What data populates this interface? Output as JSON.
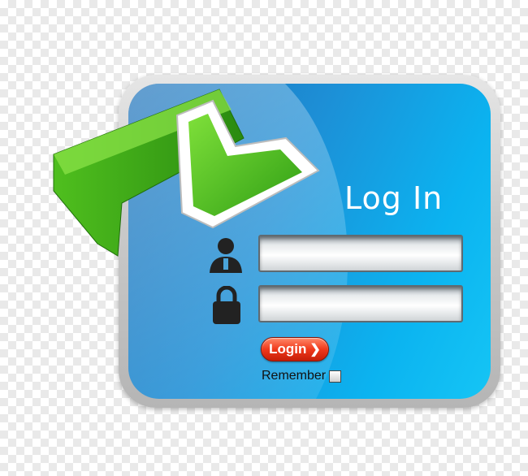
{
  "login_panel": {
    "title": "Log In",
    "username_field": {
      "value": "",
      "placeholder": ""
    },
    "password_field": {
      "value": "",
      "placeholder": ""
    },
    "login_button_label": "Login",
    "login_button_chevron": "❯",
    "remember_label": "Remember",
    "remember_checked": false
  },
  "icons": {
    "decorative_arrow": "green-arrow-icon",
    "user": "user-icon",
    "lock": "lock-icon"
  },
  "colors": {
    "panel_blue": "#0bb3f0",
    "arrow_green": "#3fbf1c",
    "button_red": "#f0391b"
  }
}
